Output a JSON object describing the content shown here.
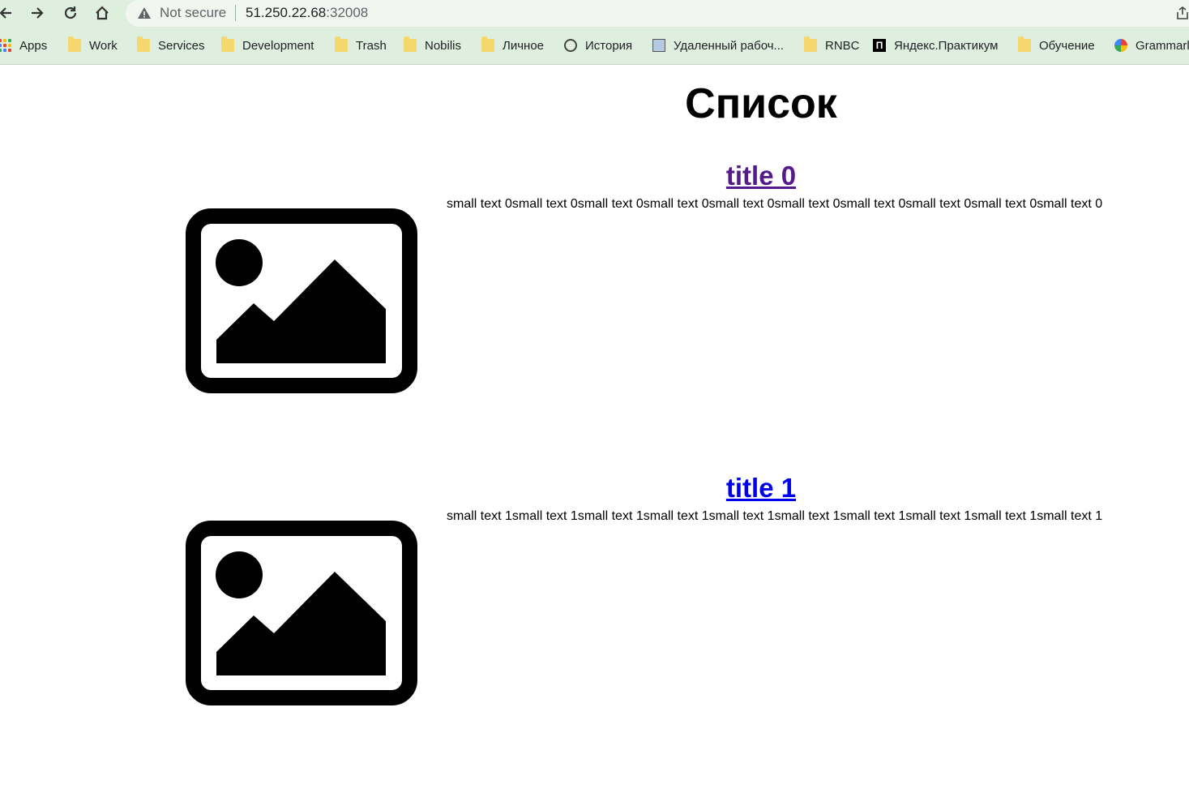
{
  "browser": {
    "security_label": "Not secure",
    "url_host": "51.250.22.68",
    "url_port": ":32008",
    "bookmarks": [
      {
        "label": "Apps",
        "icon": "apps-grid-icon"
      },
      {
        "label": "Work",
        "icon": "folder-icon"
      },
      {
        "label": "Services",
        "icon": "folder-icon"
      },
      {
        "label": "Development",
        "icon": "folder-icon"
      },
      {
        "label": "Trash",
        "icon": "folder-icon"
      },
      {
        "label": "Nobilis",
        "icon": "folder-icon"
      },
      {
        "label": "Личное",
        "icon": "folder-icon"
      },
      {
        "label": "История",
        "icon": "history-icon"
      },
      {
        "label": "Удаленный рабоч...",
        "icon": "remote-desktop-icon"
      },
      {
        "label": "RNBC",
        "icon": "folder-icon"
      },
      {
        "label": "Яндекс.Практикум",
        "icon": "yandex-practicum-icon"
      },
      {
        "label": "Обучение",
        "icon": "folder-icon"
      },
      {
        "label": "Grammarl",
        "icon": "grammarly-icon"
      }
    ]
  },
  "page": {
    "title": "Список",
    "items": [
      {
        "title": "title 0",
        "visited": true,
        "text": "small text 0small text 0small text 0small text 0small text 0small text 0small text 0small text 0small text 0small text 0",
        "image_icon": "image-placeholder-icon"
      },
      {
        "title": "title 1",
        "visited": false,
        "text": "small text 1small text 1small text 1small text 1small text 1small text 1small text 1small text 1small text 1small text 1",
        "image_icon": "image-placeholder-icon"
      }
    ]
  },
  "colors": {
    "chrome_bg": "#dfefdf",
    "visited_link": "#551a8b",
    "link": "#0000ee"
  }
}
